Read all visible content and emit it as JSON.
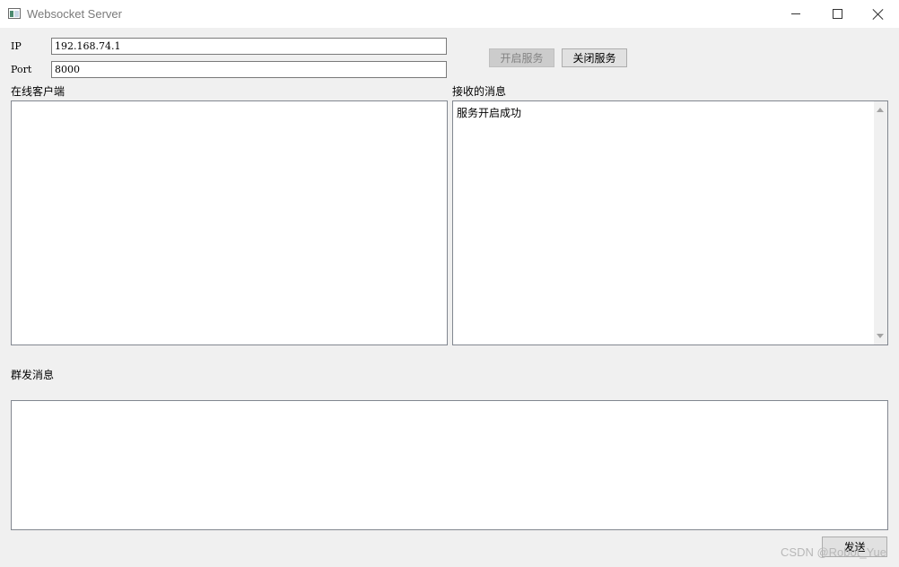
{
  "window": {
    "title": "Websocket Server",
    "icons": {
      "app": "app-window-icon",
      "minimize": "minimize-icon",
      "maximize": "maximize-icon",
      "close": "close-icon"
    }
  },
  "form": {
    "ip_label": "IP",
    "ip_value": "192.168.74.1",
    "port_label": "Port",
    "port_value": "8000",
    "start_button": "开启服务",
    "start_button_disabled": true,
    "stop_button": "关闭服务"
  },
  "clients": {
    "label": "在线客户端",
    "items": []
  },
  "messages": {
    "label": "接收的消息",
    "lines": [
      "服务开启成功"
    ]
  },
  "broadcast": {
    "label": "群发消息",
    "value": "",
    "send_button": "发送"
  },
  "watermark": "CSDN @Robot_Yue"
}
